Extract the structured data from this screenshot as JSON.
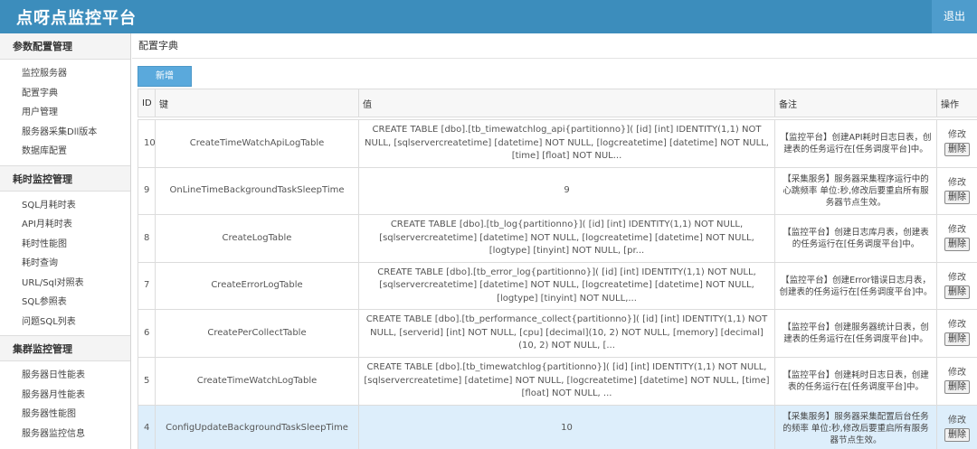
{
  "app": {
    "title": "点呀点监控平台",
    "logout": "退出"
  },
  "sidebar": {
    "groups": [
      {
        "title": "参数配置管理",
        "items": [
          "监控服务器",
          "配置字典",
          "用户管理",
          "服务器采集Dll版本",
          "数据库配置"
        ]
      },
      {
        "title": "耗时监控管理",
        "items": [
          "SQL月耗时表",
          "API月耗时表",
          "耗时性能图",
          "耗时查询",
          "URL/Sql对照表",
          "SQL参照表",
          "问题SQL列表"
        ]
      },
      {
        "title": "集群监控管理",
        "items": [
          "服务器日性能表",
          "服务器月性能表",
          "服务器性能图",
          "服务器监控信息"
        ]
      }
    ]
  },
  "main": {
    "breadcrumb": "配置字典",
    "add_label": "新增",
    "headers": {
      "id": "ID",
      "key": "键",
      "value": "值",
      "note": "备注",
      "ops": "操作"
    },
    "edit_label": "修改",
    "delete_label": "删除",
    "rows": [
      {
        "id": "10",
        "key": "CreateTimeWatchApiLogTable",
        "value": "CREATE TABLE [dbo].[tb_timewatchlog_api{partitionno}]( [id] [int] IDENTITY(1,1) NOT NULL, [sqlservercreatetime] [datetime] NOT NULL, [logcreatetime] [datetime] NOT NULL, [time] [float] NOT NUL...",
        "note": "【监控平台】创建API耗时日志日表，创建表的任务运行在[任务调度平台]中。"
      },
      {
        "id": "9",
        "key": "OnLineTimeBackgroundTaskSleepTime",
        "value": "9",
        "note": "【采集服务】服务器采集程序运行中的心跳频率 单位:秒,修改后要重启所有服务器节点生效。"
      },
      {
        "id": "8",
        "key": "CreateLogTable",
        "value": "CREATE TABLE [dbo].[tb_log{partitionno}]( [id] [int] IDENTITY(1,1) NOT NULL, [sqlservercreatetime] [datetime] NOT NULL, [logcreatetime] [datetime] NOT NULL, [logtype] [tinyint] NOT NULL, [pr...",
        "note": "【监控平台】创建日志库月表，创建表的任务运行在[任务调度平台]中。"
      },
      {
        "id": "7",
        "key": "CreateErrorLogTable",
        "value": "CREATE TABLE [dbo].[tb_error_log{partitionno}]( [id] [int] IDENTITY(1,1) NOT NULL, [sqlservercreatetime] [datetime] NOT NULL, [logcreatetime] [datetime] NOT NULL, [logtype] [tinyint] NOT NULL,...",
        "note": "【监控平台】创建Error错误日志月表，创建表的任务运行在[任务调度平台]中。"
      },
      {
        "id": "6",
        "key": "CreatePerCollectTable",
        "value": "CREATE TABLE [dbo].[tb_performance_collect{partitionno}]( [id] [int] IDENTITY(1,1) NOT NULL, [serverid] [int] NOT NULL, [cpu] [decimal](10, 2) NOT NULL, [memory] [decimal](10, 2) NOT NULL, [...",
        "note": "【监控平台】创建服务器统计日表，创建表的任务运行在[任务调度平台]中。"
      },
      {
        "id": "5",
        "key": "CreateTimeWatchLogTable",
        "value": "CREATE TABLE [dbo].[tb_timewatchlog{partitionno}]( [id] [int] IDENTITY(1,1) NOT NULL, [sqlservercreatetime] [datetime] NOT NULL, [logcreatetime] [datetime] NOT NULL, [time] [float] NOT NULL, ...",
        "note": "【监控平台】创建耗时日志日表，创建表的任务运行在[任务调度平台]中。"
      },
      {
        "id": "4",
        "key": "ConfigUpdateBackgroundTaskSleepTime",
        "value": "10",
        "note": "【采集服务】服务器采集配置后台任务的频率 单位:秒,修改后要重启所有服务器节点生效。"
      }
    ]
  }
}
